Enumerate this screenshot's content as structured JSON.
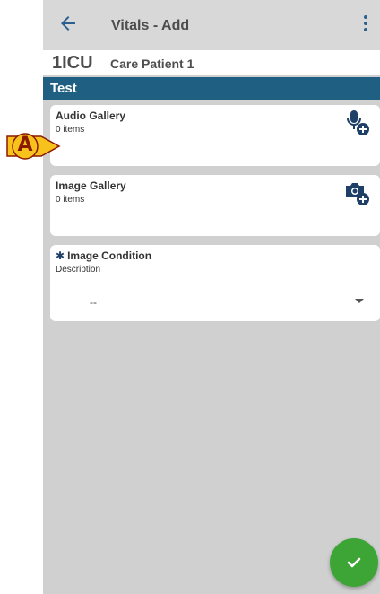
{
  "app_bar": {
    "title": "Vitals - Add",
    "back_icon": "arrow-left-icon",
    "menu_icon": "more-vertical-icon"
  },
  "patient": {
    "bed": "1ICU",
    "name": "Care Patient 1"
  },
  "section": {
    "title": "Test"
  },
  "audio_gallery": {
    "title": "Audio Gallery",
    "count": "0 items",
    "icon": "microphone-add-icon"
  },
  "image_gallery": {
    "title": "Image Gallery",
    "count": "0 items",
    "icon": "camera-add-icon"
  },
  "image_condition": {
    "required_icon": "✱",
    "title": "Image Condition",
    "label": "Description",
    "value": "--"
  },
  "confirm": {
    "icon": "checkmark-icon"
  },
  "annotation": {
    "label": "A"
  },
  "colors": {
    "primary": "#1e5f82",
    "accent": "#3da535",
    "background": "#d0d0d0"
  }
}
